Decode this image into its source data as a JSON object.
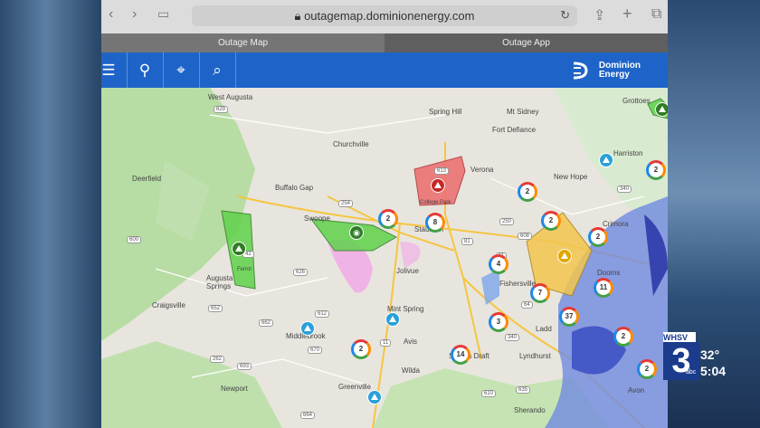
{
  "browser": {
    "url": "outagemap.dominionenergy.com"
  },
  "tabs": [
    {
      "label": "Outage Map"
    },
    {
      "label": "Outage App"
    }
  ],
  "brand": {
    "line1": "Dominion",
    "line2": "Energy"
  },
  "map": {
    "towns": [
      {
        "n": "West Augusta"
      },
      {
        "n": "Spring Hill"
      },
      {
        "n": "Mt Sidney"
      },
      {
        "n": "Fort Defiance"
      },
      {
        "n": "Churchville"
      },
      {
        "n": "Verona"
      },
      {
        "n": "New Hope"
      },
      {
        "n": "Harriston"
      },
      {
        "n": "Deerfield"
      },
      {
        "n": "Buffalo Gap"
      },
      {
        "n": "Swoope"
      },
      {
        "n": "Staunton"
      },
      {
        "n": "Crimora"
      },
      {
        "n": "Jolivue"
      },
      {
        "n": "Fishersville"
      },
      {
        "n": "Augusta Springs"
      },
      {
        "n": "Craigsville"
      },
      {
        "n": "Mint Spring"
      },
      {
        "n": "Middlebrook"
      },
      {
        "n": "Ladd"
      },
      {
        "n": "Avis"
      },
      {
        "n": "Stuarts Draft"
      },
      {
        "n": "Lyndhurst"
      },
      {
        "n": "Wilda"
      },
      {
        "n": "Newport"
      },
      {
        "n": "Greenville"
      },
      {
        "n": "Sherando"
      },
      {
        "n": "Avon"
      },
      {
        "n": "Grottoes"
      },
      {
        "n": "Ferrol"
      },
      {
        "n": "College Park"
      },
      {
        "n": "Dooms"
      }
    ],
    "roads": [
      "629",
      "600",
      "42",
      "254",
      "613",
      "340",
      "11",
      "81",
      "64",
      "250",
      "608",
      "626",
      "612",
      "662",
      "670",
      "340",
      "11",
      "693",
      "664",
      "610",
      "635",
      "262",
      "652"
    ],
    "clusters": [
      "2",
      "2",
      "8",
      "2",
      "2",
      "2",
      "4",
      "7",
      "11",
      "3",
      "37",
      "2",
      "2",
      "14",
      "2"
    ]
  },
  "tv": {
    "station": "WHSV",
    "channel": "3",
    "temperature": "32°",
    "time": "5:04",
    "network": "abc"
  }
}
